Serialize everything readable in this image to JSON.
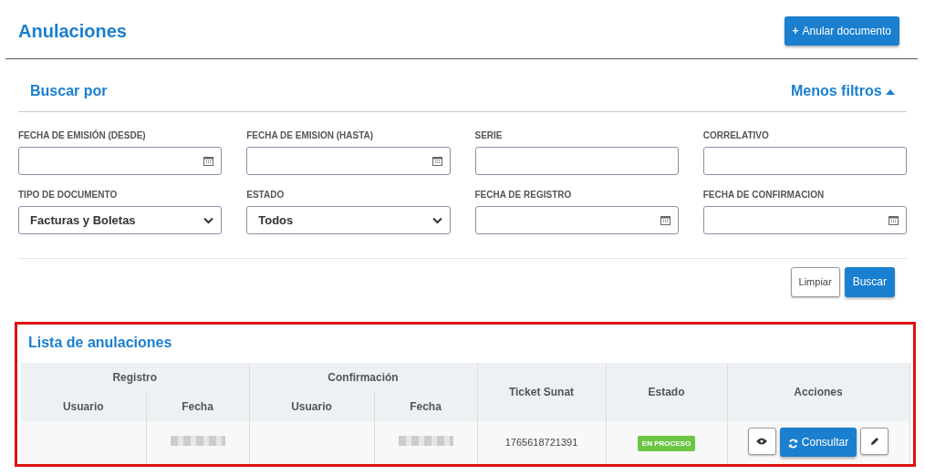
{
  "header": {
    "title": "Anulaciones",
    "action_button": {
      "icon": "+",
      "label": "Anular documento"
    }
  },
  "filters": {
    "title": "Buscar por",
    "toggle": {
      "label": "Menos filtros",
      "expanded": true
    },
    "fields": [
      {
        "label": "FECHA DE EMISIÓN (DESDE)",
        "kind": "date"
      },
      {
        "label": "FECHA DE EMISION (HASTA)",
        "kind": "date"
      },
      {
        "label": "SERIE",
        "kind": "text"
      },
      {
        "label": "CORRELATIVO",
        "kind": "text"
      },
      {
        "label": "TIPO DE DOCUMENTO",
        "kind": "select",
        "value": "Facturas y Boletas"
      },
      {
        "label": "ESTADO",
        "kind": "select",
        "value": "Todos"
      },
      {
        "label": "FECHA DE REGISTRO",
        "kind": "date"
      },
      {
        "label": "FECHA DE CONFIRMACION",
        "kind": "date"
      }
    ],
    "buttons": [
      {
        "label": "Limpiar",
        "kind": "secondary"
      },
      {
        "label": "Buscar",
        "kind": "primary"
      }
    ]
  },
  "list": {
    "title": "Lista de anulaciones",
    "highlighted": true,
    "groups": [
      {
        "label": "Registro",
        "columns": [
          "Usuario",
          "Fecha"
        ]
      },
      {
        "label": "Confirmación",
        "columns": [
          "Usuario",
          "Fecha"
        ]
      }
    ],
    "columns": [
      "Ticket Sunat",
      "Estado",
      "Acciones"
    ],
    "rows": [
      {
        "ticket": "1765618721391",
        "status": "EN PROCESO",
        "color": "#6cc644",
        "consult_label": "Consultar"
      }
    ]
  }
}
